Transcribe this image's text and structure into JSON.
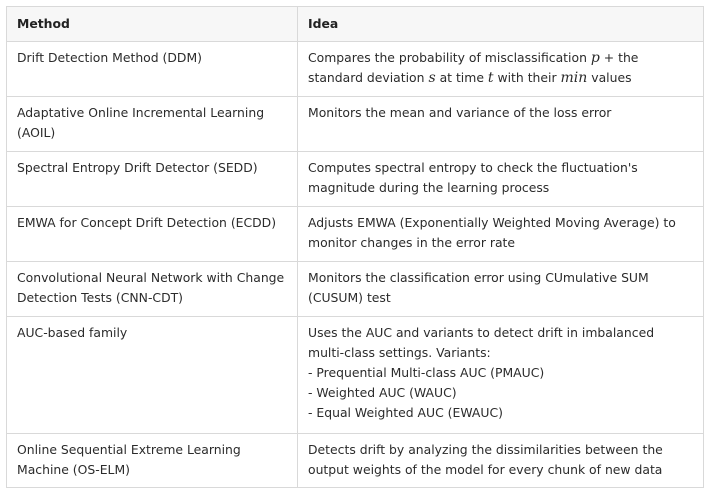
{
  "table": {
    "headers": [
      "Method",
      "Idea"
    ],
    "rows": [
      {
        "method": "Drift Detection Method (DDM)",
        "idea_parts": {
          "t1": "Compares the probability of misclassification ",
          "m1": "p",
          "t2": " + the standard deviation ",
          "m2": "s",
          "t3": " at time ",
          "m3": "t",
          "t4": " with their ",
          "m4": "min",
          "t5": " values"
        }
      },
      {
        "method": "Adaptative Online Incremental Learning (AOIL)",
        "idea": "Monitors the mean and variance of the loss error"
      },
      {
        "method": "Spectral Entropy Drift Detector (SEDD)",
        "idea": "Computes spectral entropy to check the fluctuation's magnitude during the learning process"
      },
      {
        "method": "EMWA for Concept Drift Detection (ECDD)",
        "idea": "Adjusts EMWA (Exponentially Weighted Moving Average) to monitor changes in the error rate"
      },
      {
        "method": "Convolutional Neural Network with Change Detection Tests (CNN-CDT)",
        "idea": "Monitors the classification error using CUmulative SUM (CUSUM) test"
      },
      {
        "method": "AUC-based family",
        "idea": "Uses the AUC and variants to detect drift in imbalanced multi-class settings. Variants:",
        "variants": [
          "- Prequential Multi-class AUC (PMAUC)",
          "- Weighted AUC (WAUC)",
          "- Equal Weighted AUC (EWAUC)"
        ]
      },
      {
        "method": "Online Sequential Extreme Learning Machine (OS-ELM)",
        "idea": "Detects drift by analyzing the dissimilarities between the output weights of the model for every chunk of new data"
      }
    ]
  }
}
